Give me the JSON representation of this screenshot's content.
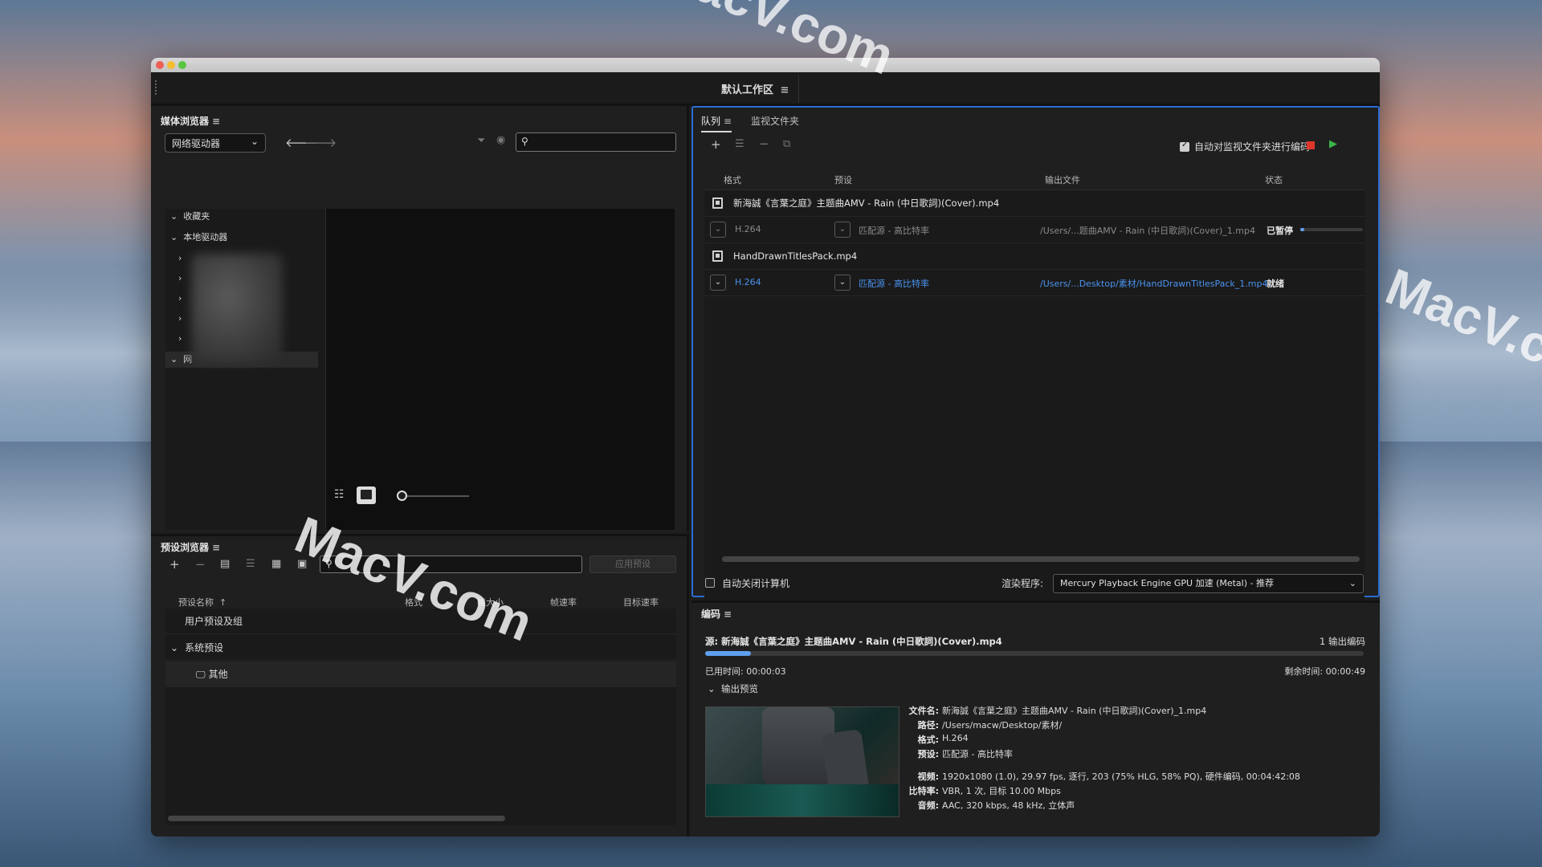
{
  "workspace": {
    "title": "默认工作区",
    "menu": "≡"
  },
  "media_browser": {
    "title": "媒体浏览器",
    "drive_select": "网络驱动器",
    "tree": {
      "favorites": "收藏夹",
      "local_drives": "本地驱动器",
      "network": "网"
    }
  },
  "preset_browser": {
    "title": "预设浏览器",
    "apply_button": "应用预设",
    "columns": {
      "name": "预设名称",
      "format": "格式",
      "frame_size": "帧大小",
      "frame_rate": "帧速率",
      "target_rate": "目标速率"
    },
    "rows": {
      "user_presets": "用户预设及组",
      "system_presets": "系统预设",
      "other": "其他"
    }
  },
  "queue": {
    "tabs": {
      "queue": "队列",
      "watch_folders": "监视文件夹"
    },
    "auto_encode_label": "自动对监视文件夹进行编码",
    "auto_encode_checked": true,
    "columns": {
      "format": "格式",
      "preset": "预设",
      "output": "输出文件",
      "status": "状态"
    },
    "items": [
      {
        "source": "新海誠《言葉之庭》主题曲AMV - Rain (中日歌詞)(Cover).mp4",
        "format": "H.264",
        "preset": "匹配源 - 高比特率",
        "output": "/Users/...题曲AMV - Rain (中日歌詞)(Cover)_1.mp4",
        "status": "已暂停",
        "progress": 0.07
      },
      {
        "source": "HandDrawnTitlesPack.mp4",
        "format": "H.264",
        "preset": "匹配源 - 高比特率",
        "output": "/Users/...Desktop/素材/HandDrawnTitlesPack_1.mp4",
        "status": "就绪"
      }
    ],
    "shutdown_label": "自动关闭计算机",
    "shutdown_checked": false,
    "renderer_label": "渲染程序:",
    "renderer_value": "Mercury Playback Engine GPU 加速 (Metal) - 推荐"
  },
  "encoding": {
    "title": "编码",
    "source": "源: 新海誠《言葉之庭》主题曲AMV - Rain (中日歌詞)(Cover).mp4",
    "output_count": "1 输出编码",
    "progress": 0.07,
    "elapsed": "已用时间: 00:00:03",
    "remaining": "剩余时间: 00:00:49",
    "output_preview": "输出预览",
    "info": {
      "filename_label": "文件名:",
      "filename": "新海誠《言葉之庭》主题曲AMV - Rain (中日歌詞)(Cover)_1.mp4",
      "path_label": "路径:",
      "path": "/Users/macw/Desktop/素材/",
      "format_label": "格式:",
      "format": "H.264",
      "preset_label": "预设:",
      "preset": "匹配源 - 高比特率",
      "video_label": "视频:",
      "video": "1920x1080 (1.0), 29.97 fps, 逐行, 203 (75% HLG, 58% PQ), 硬件编码, 00:04:42:08",
      "bitrate_label": "比特率:",
      "bitrate": "VBR, 1 次, 目标 10.00 Mbps",
      "audio_label": "音频:",
      "audio": "AAC, 320 kbps, 48 kHz, 立体声"
    }
  },
  "watermark": "MacV.com",
  "colors": {
    "accent": "#2b6cd4",
    "link": "#4b93f0",
    "stop": "#e0362c",
    "start": "#39b54a",
    "progress": "#5ea0ef"
  }
}
